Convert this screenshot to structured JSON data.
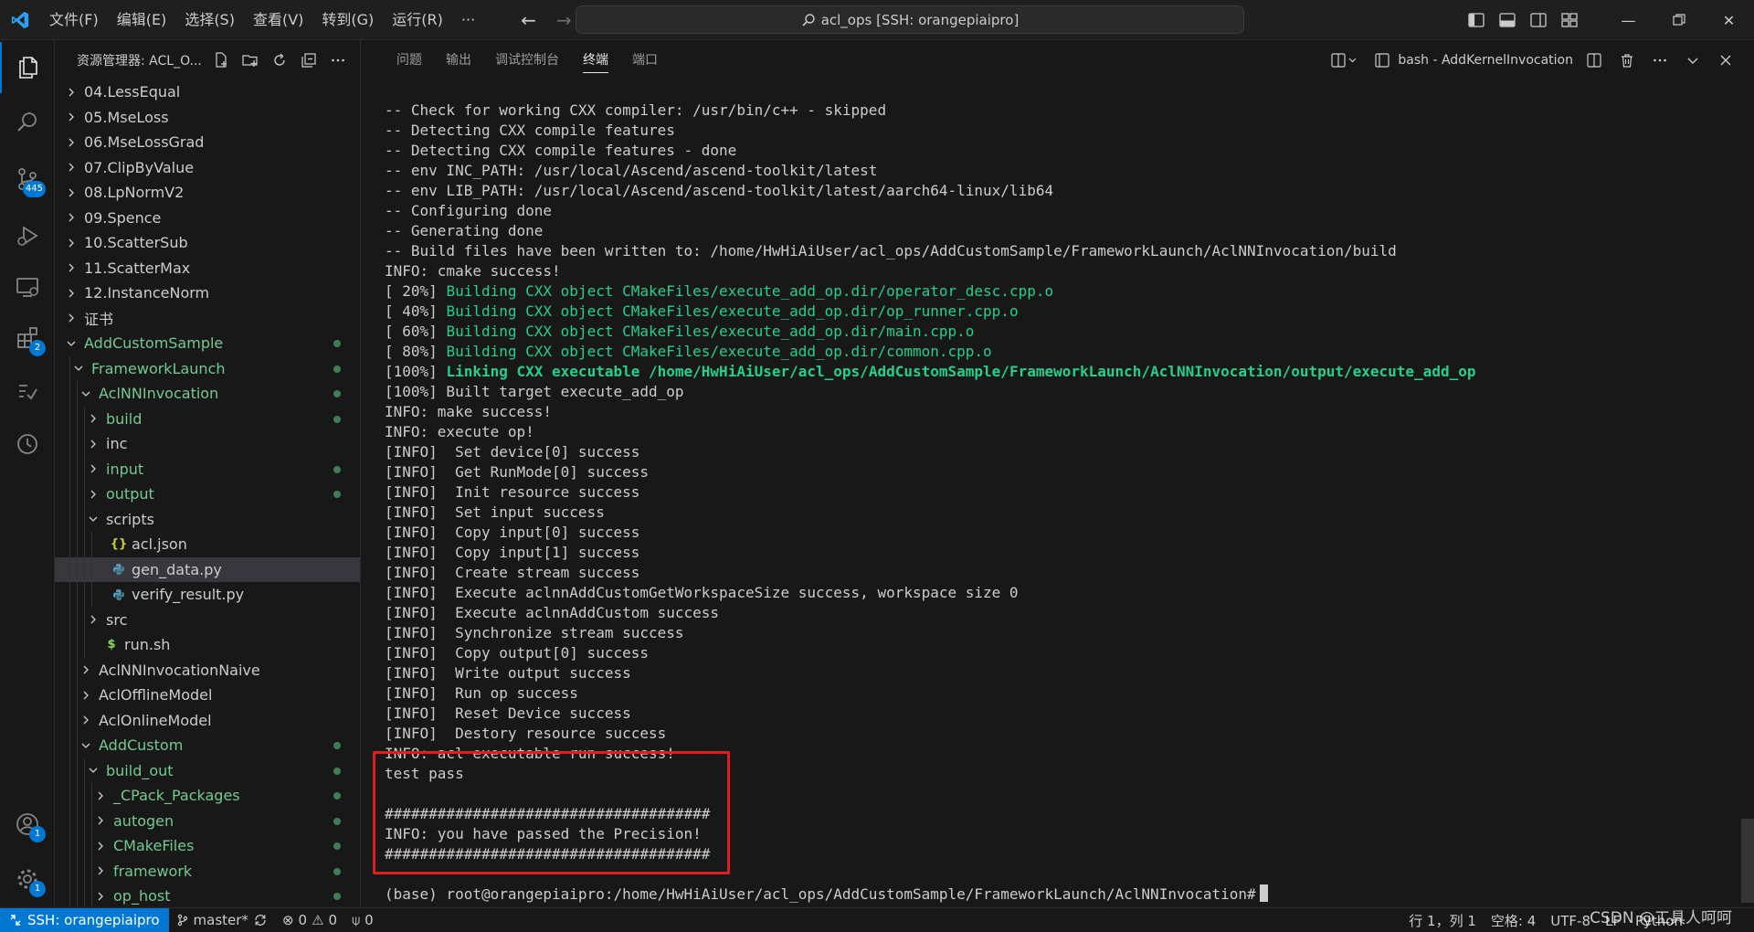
{
  "window": {
    "search_title": "acl_ops [SSH: orangepiaipro]"
  },
  "menu": [
    "文件(F)",
    "编辑(E)",
    "选择(S)",
    "查看(V)",
    "转到(G)",
    "运行(R)",
    "···"
  ],
  "activity": {
    "scm_badge": "445",
    "extensions_badge": "2",
    "accounts_badge": "1",
    "settings_badge": "1"
  },
  "sidebar": {
    "title": "资源管理器: ACL_O...",
    "tree": [
      {
        "label": "04.LessEqual",
        "type": "folder",
        "open": false,
        "depth": 0
      },
      {
        "label": "05.MseLoss",
        "type": "folder",
        "open": false,
        "depth": 0
      },
      {
        "label": "06.MseLossGrad",
        "type": "folder",
        "open": false,
        "depth": 0
      },
      {
        "label": "07.ClipByValue",
        "type": "folder",
        "open": false,
        "depth": 0
      },
      {
        "label": "08.LpNormV2",
        "type": "folder",
        "open": false,
        "depth": 0
      },
      {
        "label": "09.Spence",
        "type": "folder",
        "open": false,
        "depth": 0
      },
      {
        "label": "10.ScatterSub",
        "type": "folder",
        "open": false,
        "depth": 0
      },
      {
        "label": "11.ScatterMax",
        "type": "folder",
        "open": false,
        "depth": 0
      },
      {
        "label": "12.InstanceNorm",
        "type": "folder",
        "open": false,
        "depth": 0
      },
      {
        "label": "证书",
        "type": "folder",
        "open": false,
        "depth": 0
      },
      {
        "label": "AddCustomSample",
        "type": "folder",
        "open": true,
        "depth": 0,
        "modified": true
      },
      {
        "label": "FrameworkLaunch",
        "type": "folder",
        "open": true,
        "depth": 1,
        "modified": true
      },
      {
        "label": "AclNNInvocation",
        "type": "folder",
        "open": true,
        "depth": 2,
        "modified": true
      },
      {
        "label": "build",
        "type": "folder",
        "open": false,
        "depth": 3,
        "modified": true
      },
      {
        "label": "inc",
        "type": "folder",
        "open": false,
        "depth": 3
      },
      {
        "label": "input",
        "type": "folder",
        "open": false,
        "depth": 3,
        "modified": true
      },
      {
        "label": "output",
        "type": "folder",
        "open": false,
        "depth": 3,
        "modified": true
      },
      {
        "label": "scripts",
        "type": "folder",
        "open": true,
        "depth": 3
      },
      {
        "label": "acl.json",
        "type": "json",
        "depth": 4
      },
      {
        "label": "gen_data.py",
        "type": "python",
        "depth": 4,
        "selected": true
      },
      {
        "label": "verify_result.py",
        "type": "python",
        "depth": 4
      },
      {
        "label": "src",
        "type": "folder",
        "open": false,
        "depth": 3
      },
      {
        "label": "run.sh",
        "type": "shell",
        "depth": 3
      },
      {
        "label": "AclNNInvocationNaive",
        "type": "folder",
        "open": false,
        "depth": 2
      },
      {
        "label": "AclOfflineModel",
        "type": "folder",
        "open": false,
        "depth": 2
      },
      {
        "label": "AclOnlineModel",
        "type": "folder",
        "open": false,
        "depth": 2
      },
      {
        "label": "AddCustom",
        "type": "folder",
        "open": true,
        "depth": 2,
        "modified": true
      },
      {
        "label": "build_out",
        "type": "folder",
        "open": true,
        "depth": 3,
        "modified": true
      },
      {
        "label": "_CPack_Packages",
        "type": "folder",
        "open": false,
        "depth": 4,
        "modified": true
      },
      {
        "label": "autogen",
        "type": "folder",
        "open": false,
        "depth": 4,
        "modified": true
      },
      {
        "label": "CMakeFiles",
        "type": "folder",
        "open": false,
        "depth": 4,
        "modified": true
      },
      {
        "label": "framework",
        "type": "folder",
        "open": false,
        "depth": 4,
        "modified": true
      },
      {
        "label": "op_host",
        "type": "folder",
        "open": false,
        "depth": 4,
        "modified": true
      }
    ]
  },
  "panel": {
    "tabs": [
      {
        "label": "问题",
        "active": false
      },
      {
        "label": "输出",
        "active": false
      },
      {
        "label": "调试控制台",
        "active": false
      },
      {
        "label": "终端",
        "active": true
      },
      {
        "label": "端口",
        "active": false
      }
    ],
    "terminal_name": "bash - AddKernelInvocation"
  },
  "terminal": {
    "lines": [
      {
        "text": "-- Check for working CXX compiler: /usr/bin/c++ - skipped"
      },
      {
        "text": "-- Detecting CXX compile features"
      },
      {
        "text": "-- Detecting CXX compile features - done"
      },
      {
        "text": "-- env INC_PATH: /usr/local/Ascend/ascend-toolkit/latest"
      },
      {
        "text": "-- env LIB_PATH: /usr/local/Ascend/ascend-toolkit/latest/aarch64-linux/lib64"
      },
      {
        "text": "-- Configuring done"
      },
      {
        "text": "-- Generating done"
      },
      {
        "text": "-- Build files have been written to: /home/HwHiAiUser/acl_ops/AddCustomSample/FrameworkLaunch/AclNNInvocation/build"
      },
      {
        "text": "INFO: cmake success!"
      },
      {
        "prefix": "[ 20%] ",
        "text": "Building CXX object CMakeFiles/execute_add_op.dir/operator_desc.cpp.o",
        "style": "green"
      },
      {
        "prefix": "[ 40%] ",
        "text": "Building CXX object CMakeFiles/execute_add_op.dir/op_runner.cpp.o",
        "style": "green"
      },
      {
        "prefix": "[ 60%] ",
        "text": "Building CXX object CMakeFiles/execute_add_op.dir/main.cpp.o",
        "style": "green"
      },
      {
        "prefix": "[ 80%] ",
        "text": "Building CXX object CMakeFiles/execute_add_op.dir/common.cpp.o",
        "style": "green"
      },
      {
        "prefix": "[100%] ",
        "text": "Linking CXX executable /home/HwHiAiUser/acl_ops/AddCustomSample/FrameworkLaunch/AclNNInvocation/output/execute_add_op",
        "style": "greenb"
      },
      {
        "text": "[100%] Built target execute_add_op"
      },
      {
        "text": "INFO: make success!"
      },
      {
        "text": "INFO: execute op!"
      },
      {
        "text": "[INFO]  Set device[0] success"
      },
      {
        "text": "[INFO]  Get RunMode[0] success"
      },
      {
        "text": "[INFO]  Init resource success"
      },
      {
        "text": "[INFO]  Set input success"
      },
      {
        "text": "[INFO]  Copy input[0] success"
      },
      {
        "text": "[INFO]  Copy input[1] success"
      },
      {
        "text": "[INFO]  Create stream success"
      },
      {
        "text": "[INFO]  Execute aclnnAddCustomGetWorkspaceSize success, workspace size 0"
      },
      {
        "text": "[INFO]  Execute aclnnAddCustom success"
      },
      {
        "text": "[INFO]  Synchronize stream success"
      },
      {
        "text": "[INFO]  Copy output[0] success"
      },
      {
        "text": "[INFO]  Write output success"
      },
      {
        "text": "[INFO]  Run op success"
      },
      {
        "text": "[INFO]  Reset Device success"
      },
      {
        "text": "[INFO]  Destory resource success"
      },
      {
        "text": "INFO: acl executable run success!"
      },
      {
        "text": "test pass"
      },
      {
        "text": ""
      },
      {
        "text": "#####################################"
      },
      {
        "text": "INFO: you have passed the Precision!"
      },
      {
        "text": "#####################################"
      },
      {
        "text": ""
      },
      {
        "text": "(base) root@orangepiaipro:/home/HwHiAiUser/acl_ops/AddCustomSample/FrameworkLaunch/AclNNInvocation#"
      }
    ]
  },
  "status": {
    "remote": "SSH: orangepiaipro",
    "branch": "master*",
    "errors": "0",
    "warnings": "0",
    "ports": "0",
    "position": "行 1，列 1",
    "spaces": "空格: 4",
    "encoding": "UTF-8",
    "eol": "LF",
    "language": "Python",
    "watermark": "CSDN @工具人呵呵"
  }
}
